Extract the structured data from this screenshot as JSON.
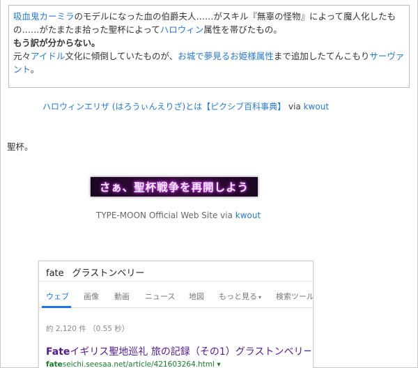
{
  "quote": {
    "l1_link1": "吸血鬼カーミラ",
    "l1_t1": "のモデルになった血の伯爵夫人……がスキル『無辜の怪物』によって魔人化したも",
    "l2_t1": "の……がたまたま拾った聖杯によって",
    "l2_link": "ハロウィン",
    "l2_t2": "属性を帯びたもの。",
    "l3_bold": "もう訳が分からない。",
    "l4_t1": "元々",
    "l4_link1": "アイドル",
    "l4_t2": "文化に傾倒していたものが、",
    "l4_link2": "お城で夢見るお姫様属性",
    "l4_t3": "まで追加したてんこもり",
    "l4_link3": "サーヴァント",
    "l4_t4": "。"
  },
  "caption1": {
    "title": "ハロウィンエリザ (はろうぃんえりざ)とは【ピクシブ百科事典】",
    "via": "via",
    "source": "kwout"
  },
  "paragraph": "聖杯。",
  "banner": {
    "text": "さぁ、聖杯戦争を再開しよう"
  },
  "caption2": {
    "title": "TYPE-MOON Official Web Site",
    "via": "via",
    "source": "kwout"
  },
  "serp": {
    "query_a": "fate",
    "query_b": "グラストンベリー",
    "tabs": [
      "ウェブ",
      "画像",
      "動画",
      "ニュース",
      "地図",
      "もっと見る",
      "検索ツール"
    ],
    "more_caret": "▾",
    "stats": "約 2,120 件 （0.55 秒）",
    "result_title_bold": "Fate",
    "result_title": "イギリス聖地巡礼 旅の記録（その1）グラストンベリー…",
    "result_url_bold": "fate",
    "result_url": "seichi.seesaa.net/article/421603264.html ▾"
  }
}
